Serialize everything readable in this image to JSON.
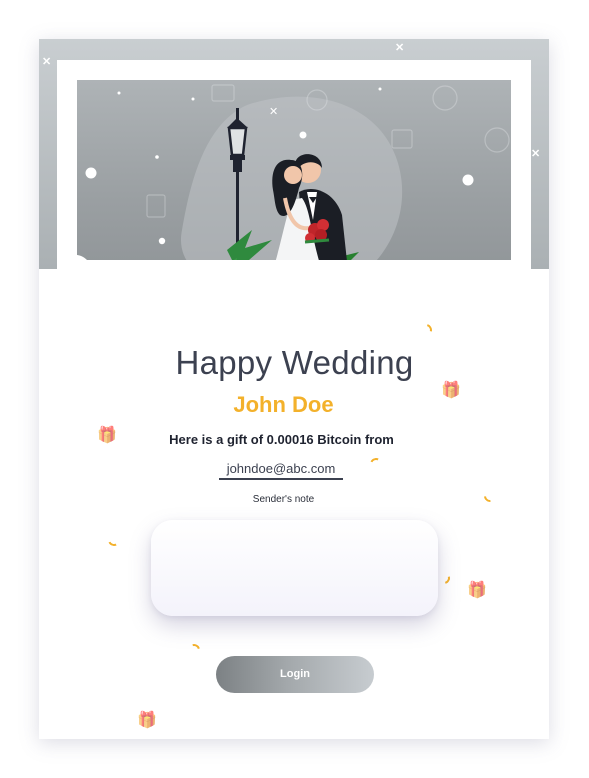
{
  "card": {
    "title": "Happy Wedding",
    "recipient_name": "John Doe",
    "gift_text": "Here is a gift of 0.00016 Bitcoin from",
    "sender_email": "johndoe@abc.com",
    "note_label": "Sender's note",
    "note_value": "",
    "login_label": "Login"
  },
  "colors": {
    "title": "#3c4150",
    "name_accent": "#f3b12b",
    "frame_gray": "#8f9598"
  },
  "icons": {
    "couple_illustration": "wedding-couple",
    "lamp": "street-lamp",
    "decorations": "gift-box"
  }
}
